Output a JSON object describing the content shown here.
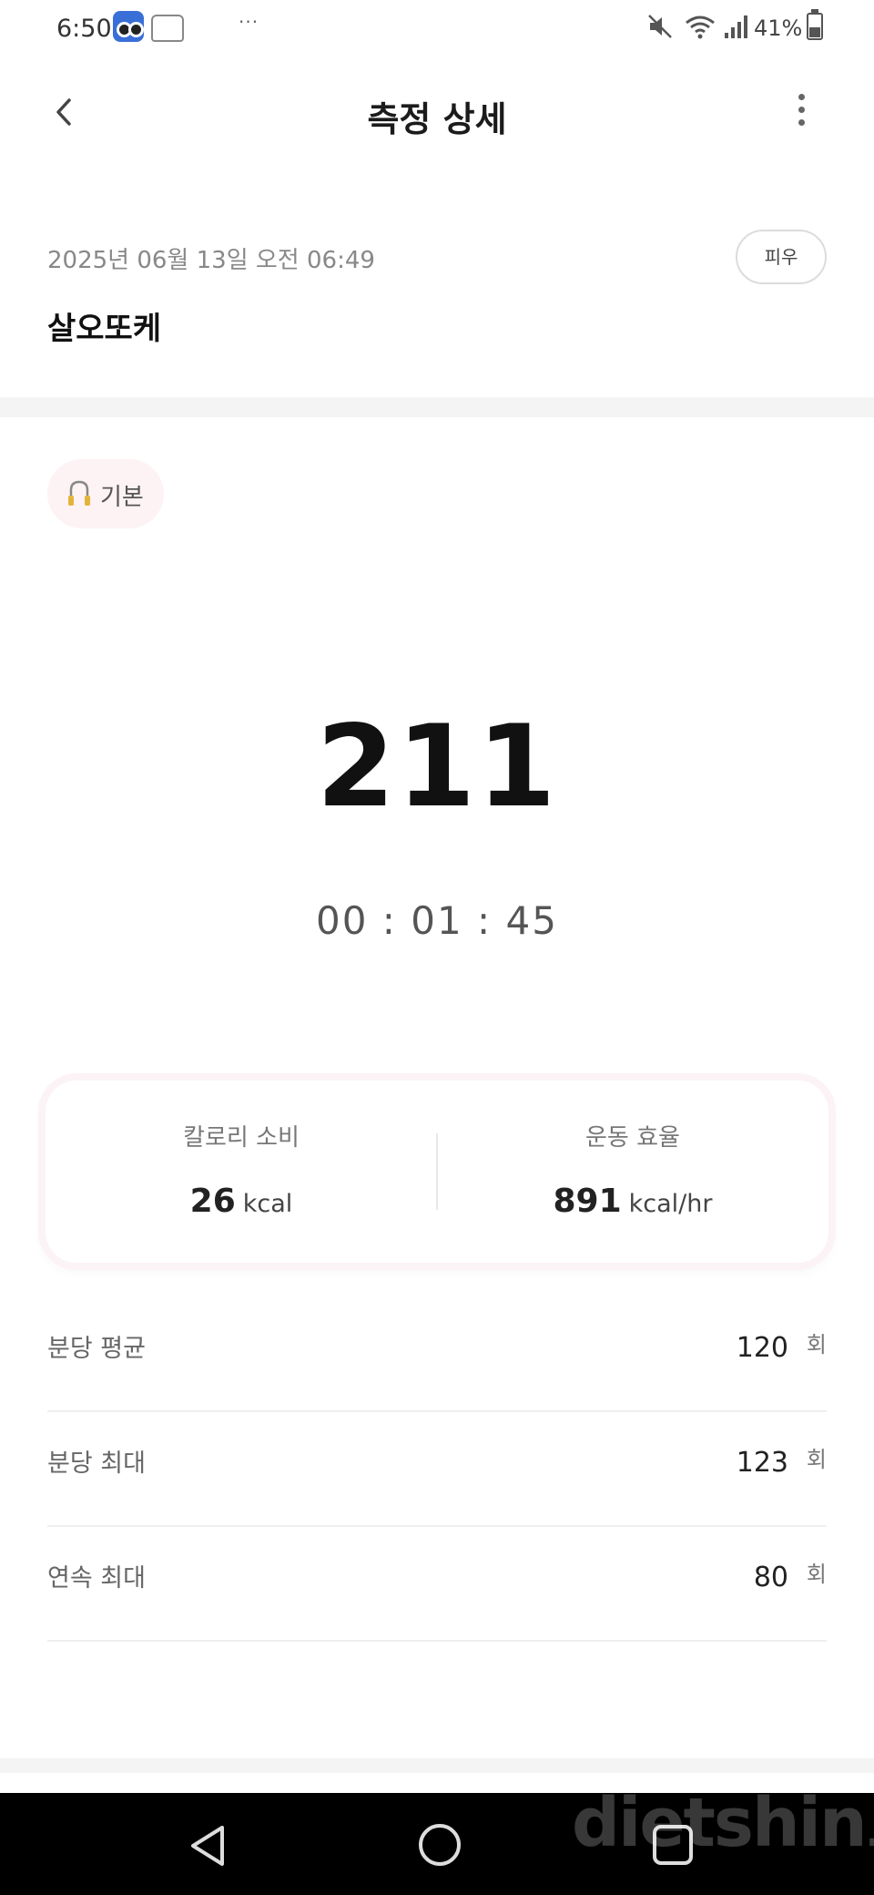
{
  "status_bar": {
    "time": "6:50",
    "more_indicator": "···",
    "battery_text": "41%",
    "battery_level_percent": 41,
    "icons": [
      "app-icon",
      "app-icon",
      "mute-icon",
      "wifi-icon",
      "signal-icon",
      "battery-icon"
    ]
  },
  "header": {
    "title": "측정 상세",
    "back_icon": "chevron-left-icon",
    "more_icon": "more-vertical-icon"
  },
  "record": {
    "datetime": "2025년 06월 13일 오전 06:49",
    "name": "살오또케",
    "user_chip": "피우"
  },
  "mode": {
    "label": "기본",
    "icon": "jump-rope-icon"
  },
  "result": {
    "count": "211",
    "duration": "00 : 01 : 45"
  },
  "summary": {
    "calories": {
      "label": "칼로리 소비",
      "value": "26",
      "unit": "kcal"
    },
    "efficiency": {
      "label": "운동 효율",
      "value": "891",
      "unit": "kcal/hr"
    }
  },
  "stats": [
    {
      "label": "분당 평균",
      "value": "120",
      "unit": "회"
    },
    {
      "label": "분당 최대",
      "value": "123",
      "unit": "회"
    },
    {
      "label": "연속 최대",
      "value": "80",
      "unit": "회"
    }
  ],
  "nav_bar": {
    "icons": [
      "back-triangle-icon",
      "home-circle-icon",
      "recent-square-icon"
    ]
  },
  "watermark": {
    "text": "dietshin",
    "suffix": ".com"
  },
  "colors": {
    "accent_chip_bg": "#fdf2f4",
    "divider": "#f4f4f4",
    "nav_bg": "#000000"
  }
}
